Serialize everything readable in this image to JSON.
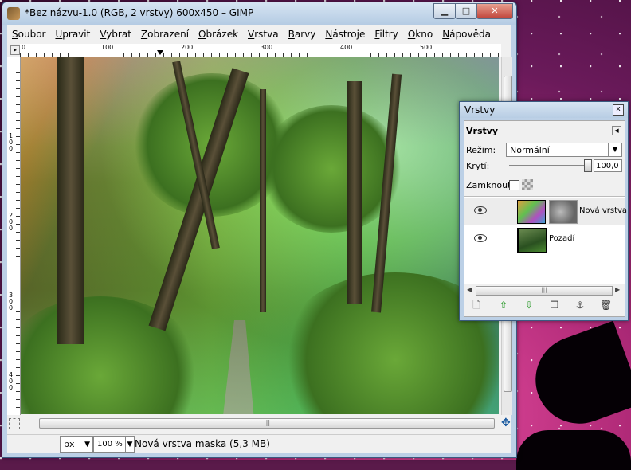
{
  "window": {
    "title": "*Bez názvu-1.0 (RGB, 2 vrstvy) 600x450 – GIMP",
    "minimize_glyph": "▁",
    "maximize_glyph": "□",
    "close_glyph": "✕"
  },
  "menu": [
    {
      "u": "S",
      "rest": "oubor"
    },
    {
      "u": "U",
      "rest": "pravit"
    },
    {
      "u": "V",
      "rest": "ybrat"
    },
    {
      "u": "Z",
      "rest": "obrazení"
    },
    {
      "u": "O",
      "rest": "brázek"
    },
    {
      "u": "V",
      "rest": "rstva"
    },
    {
      "u": "B",
      "rest": "arvy"
    },
    {
      "u": "N",
      "rest": "ástroje"
    },
    {
      "u": "F",
      "rest": "iltry"
    },
    {
      "u": "O",
      "rest": "kno"
    },
    {
      "u": "N",
      "rest": "ápověda"
    }
  ],
  "rulers": {
    "h_ticks": [
      "0",
      "100",
      "200",
      "300",
      "400",
      "500"
    ],
    "v_ticks": [
      "100",
      "200",
      "300",
      "400"
    ]
  },
  "statusbar": {
    "unit": "px",
    "zoom": "100 %",
    "message": "Nová vrstva maska (5,3 MB)"
  },
  "layers_dialog": {
    "window_title": "Vrstvy",
    "header": "Vrstvy",
    "mode_label": "Režim:",
    "mode_value": "Normální",
    "opacity_label": "Krytí:",
    "opacity_value": "100,0",
    "opacity_fraction": 1.0,
    "lock_label": "Zamknout:",
    "layers": [
      {
        "name": "Nová vrstva",
        "has_mask": true,
        "visible": true,
        "selected": true
      },
      {
        "name": "Pozadí",
        "has_mask": false,
        "visible": true,
        "selected": false
      }
    ]
  },
  "colors": {
    "titlebar": "#c4d7eb",
    "close_button": "#c0443a",
    "desktop": "#b02a78"
  }
}
